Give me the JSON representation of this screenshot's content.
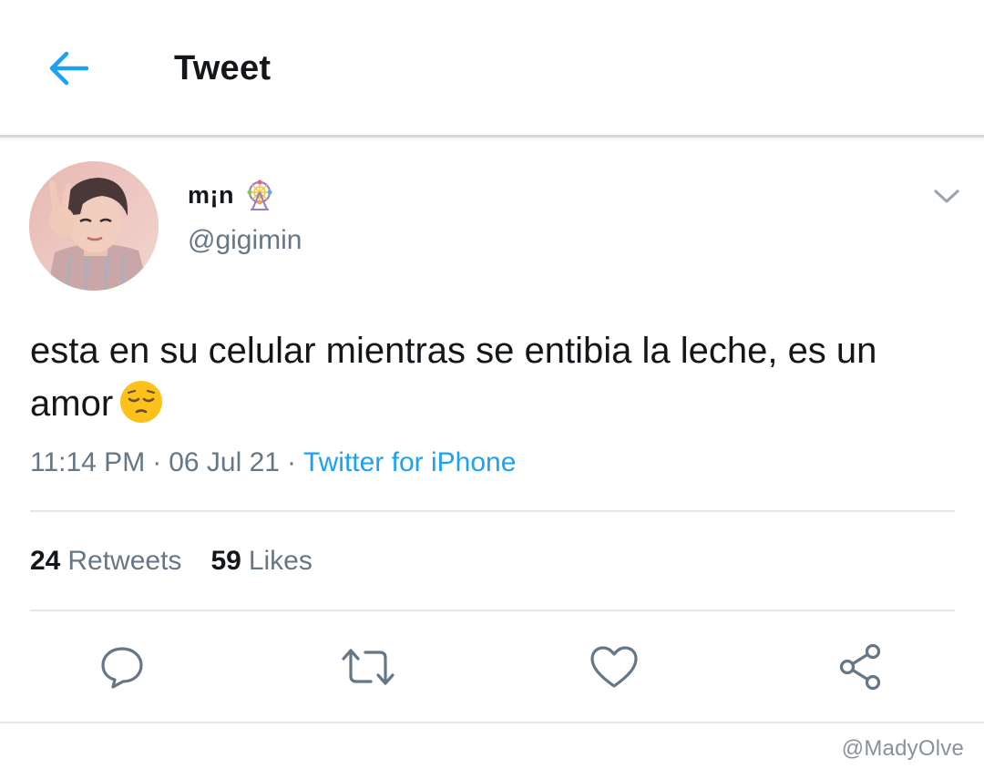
{
  "header": {
    "title": "Tweet",
    "back_icon": "arrow-left-icon",
    "accent_color": "#1da1f2"
  },
  "author": {
    "name": "m¡n",
    "name_emoji": "ferris-wheel-emoji",
    "handle": "@gigimin"
  },
  "tweet": {
    "text": "esta en su celular mientras se entibia la leche, es un amor",
    "emoji": "pensive-face-emoji"
  },
  "meta": {
    "time": "11:14 PM",
    "date": "06 Jul 21",
    "separator": "·",
    "source": "Twitter for iPhone"
  },
  "stats": {
    "retweets_count": "24",
    "retweets_label": "Retweets",
    "likes_count": "59",
    "likes_label": "Likes"
  },
  "actions": [
    "reply-icon",
    "retweet-icon",
    "like-icon",
    "share-icon"
  ],
  "watermark": "@MadyOlve"
}
